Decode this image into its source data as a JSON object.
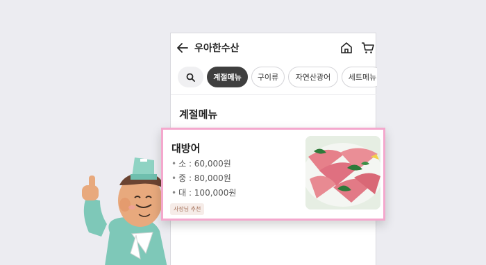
{
  "header": {
    "title": "우아한수산",
    "icons": [
      "back-arrow-icon",
      "home-icon",
      "cart-icon"
    ]
  },
  "chips": {
    "search_icon": "search-icon",
    "items": [
      {
        "label": "계절메뉴",
        "active": true
      },
      {
        "label": "구이류",
        "active": false
      },
      {
        "label": "자연산광어",
        "active": false
      },
      {
        "label": "세트메뉴",
        "active": false
      }
    ]
  },
  "section": {
    "title": "계절메뉴"
  },
  "item": {
    "name": "대방어",
    "prices": [
      {
        "size": "소",
        "price": "60,000원"
      },
      {
        "size": "중",
        "price": "80,000원"
      },
      {
        "size": "대",
        "price": "100,000원"
      }
    ],
    "badge": "사장님 추천",
    "image": "fish-sashimi-photo"
  },
  "colors": {
    "background": "#ececf1",
    "active_chip": "#3f3f3f",
    "highlight_border": "#f4a8cd",
    "badge_bg": "#f6ece8",
    "badge_text": "#a5735c"
  }
}
